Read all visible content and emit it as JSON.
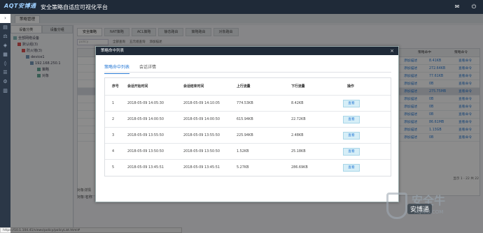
{
  "app": {
    "logo_text": "AQT安博通",
    "title": "安全策略自适应可视化平台"
  },
  "breadcrumb": {
    "tab": "策略管理"
  },
  "left_panel": {
    "tabs": [
      "设备分类",
      "设备分组"
    ],
    "tree": [
      "全部网络设备",
      "默认组(3)",
      "防火墙(3)",
      "device1",
      "192.168.250.1",
      "策略",
      "对象"
    ]
  },
  "main": {
    "tabs": [
      "安全策略",
      "NAT策略",
      "ACL策略",
      "静态路由",
      "策略路由",
      "对象路由"
    ],
    "search_placeholder": "policy",
    "toolbar": [
      "全部查询",
      "五元组查询",
      "添加描述"
    ],
    "bg_headers": [
      "策略命中",
      "策略命令"
    ],
    "bg_rows": [
      {
        "desc": "添加描述",
        "size": "8.41KB",
        "cmd": "查看命令"
      },
      {
        "desc": "添加描述",
        "size": "272.64KB",
        "cmd": "查看命令"
      },
      {
        "desc": "添加描述",
        "size": "77.61KB",
        "cmd": "查看命令"
      },
      {
        "desc": "添加描述",
        "size": "0B",
        "cmd": "查看命令"
      },
      {
        "desc": "添加描述",
        "size": "275.75MB",
        "cmd": "查看命令"
      },
      {
        "desc": "添加描述",
        "size": "0B",
        "cmd": "查看命令"
      },
      {
        "desc": "添加描述",
        "size": "0B",
        "cmd": "查看命令"
      },
      {
        "desc": "添加描述",
        "size": "0B",
        "cmd": "查看命令"
      },
      {
        "desc": "添加描述",
        "size": "86.61MB",
        "cmd": "查看命令"
      },
      {
        "desc": "添加描述",
        "size": "1.13GB",
        "cmd": "查看命令"
      },
      {
        "desc": "添加描述",
        "size": "0B",
        "cmd": "查看命令"
      }
    ],
    "pagination": "显示 1 - 22 共 22",
    "bottom": {
      "label1": "对象详情",
      "label2": "对象-名称"
    }
  },
  "status_url": "https://10.1.104.41/views/policy/policyList.html#",
  "modal": {
    "title": "策略命中列表",
    "close": "×",
    "tabs": [
      "策略命中列表",
      "会话详情"
    ],
    "headers": [
      "序号",
      "会话开始时间",
      "会话结束时间",
      "上行流量",
      "下行流量",
      "操作"
    ],
    "rows": [
      {
        "no": "1",
        "start": "2018-05-09 14:05:30",
        "end": "2018-05-09 14:10:05",
        "up": "774.53KB",
        "down": "8.42KB",
        "action": "查看"
      },
      {
        "no": "2",
        "start": "2018-05-09 14:00:50",
        "end": "2018-05-09 14:00:50",
        "up": "615.94KB",
        "down": "22.72KB",
        "action": "查看"
      },
      {
        "no": "3",
        "start": "2018-05-09 13:55:50",
        "end": "2018-05-09 13:55:50",
        "up": "225.94KB",
        "down": "2.48KB",
        "action": "查看"
      },
      {
        "no": "4",
        "start": "2018-05-09 13:50:50",
        "end": "2018-05-09 13:50:50",
        "up": "1.52KB",
        "down": "25.18KB",
        "action": "查看"
      },
      {
        "no": "5",
        "start": "2018-05-09 13:45:51",
        "end": "2018-05-09 13:45:51",
        "up": "5.27KB",
        "down": "286.69KB",
        "action": "查看"
      }
    ]
  },
  "watermark": {
    "main": "安全牛",
    "sub": "AQNIU.COM",
    "badge": "安博通"
  }
}
